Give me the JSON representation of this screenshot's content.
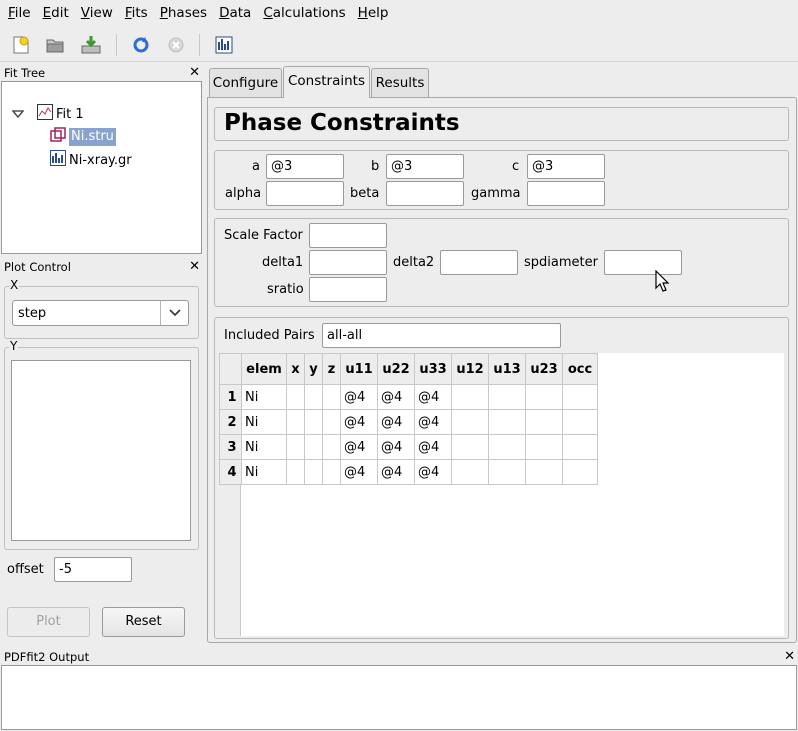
{
  "menubar": [
    {
      "mnemonic": "F",
      "rest": "ile"
    },
    {
      "mnemonic": "E",
      "rest": "dit"
    },
    {
      "mnemonic": "V",
      "rest": "iew"
    },
    {
      "mnemonic": "F",
      "rest": "its"
    },
    {
      "mnemonic": "P",
      "rest": "hases"
    },
    {
      "mnemonic": "D",
      "rest": "ata"
    },
    {
      "mnemonic": "C",
      "rest": "alculations"
    },
    {
      "mnemonic": "H",
      "rest": "elp"
    }
  ],
  "toolbar_icons": [
    "new-fit-icon",
    "open-icon",
    "save-icon",
    "refresh-icon",
    "stop-icon",
    "plot-icon"
  ],
  "fit_tree": {
    "title": "Fit Tree",
    "fit_label": "Fit 1",
    "phase_label": "Ni.stru",
    "dataset_label": "Ni-xray.gr"
  },
  "plot_control": {
    "title": "Plot Control",
    "x_label": "X",
    "x_value": "step",
    "y_label": "Y",
    "offset_label": "offset",
    "offset_value": "-5",
    "plot_label": "Plot",
    "reset_label": "Reset"
  },
  "tabs": {
    "configure": "Configure",
    "constraints": "Constraints",
    "results": "Results"
  },
  "constraints": {
    "heading": "Phase Constraints",
    "lattice": {
      "a_label": "a",
      "a_value": "@3",
      "b_label": "b",
      "b_value": "@3",
      "c_label": "c",
      "c_value": "@3",
      "alpha_label": "alpha",
      "alpha_value": "",
      "beta_label": "beta",
      "beta_value": "",
      "gamma_label": "gamma",
      "gamma_value": ""
    },
    "params": {
      "scale_label": "Scale Factor",
      "scale_value": "",
      "delta1_label": "delta1",
      "delta1_value": "",
      "delta2_label": "delta2",
      "delta2_value": "",
      "spdiameter_label": "spdiameter",
      "spdiameter_value": "",
      "sratio_label": "sratio",
      "sratio_value": ""
    },
    "pairs_label": "Included Pairs",
    "pairs_value": "all-all",
    "table": {
      "columns": [
        "elem",
        "x",
        "y",
        "z",
        "u11",
        "u22",
        "u33",
        "u12",
        "u13",
        "u23",
        "occ"
      ],
      "rows": [
        {
          "num": "1",
          "cells": [
            "Ni",
            "",
            "",
            "",
            "@4",
            "@4",
            "@4",
            "",
            "",
            "",
            ""
          ]
        },
        {
          "num": "2",
          "cells": [
            "Ni",
            "",
            "",
            "",
            "@4",
            "@4",
            "@4",
            "",
            "",
            "",
            ""
          ]
        },
        {
          "num": "3",
          "cells": [
            "Ni",
            "",
            "",
            "",
            "@4",
            "@4",
            "@4",
            "",
            "",
            "",
            ""
          ]
        },
        {
          "num": "4",
          "cells": [
            "Ni",
            "",
            "",
            "",
            "@4",
            "@4",
            "@4",
            "",
            "",
            "",
            ""
          ]
        }
      ]
    }
  },
  "output": {
    "title": "PDFfit2 Output"
  }
}
